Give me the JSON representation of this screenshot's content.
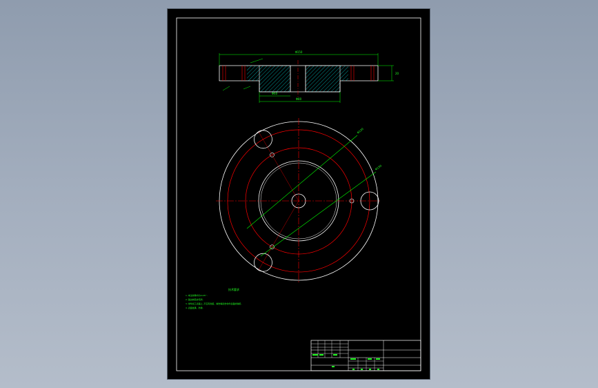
{
  "window": {
    "background": "#9aa6b6"
  },
  "colors": {
    "sheet": "#000000",
    "outline": "#ffffff",
    "centerline": "#ff0000",
    "dimension": "#00ff00",
    "section_hatch": "#00ffff",
    "annotation_text": "#22ff22"
  },
  "drawing": {
    "type": "flange part drawing",
    "views": [
      "section-view",
      "top-view"
    ],
    "top_view": {
      "bolt_holes_large": 3,
      "small_holes": 3
    },
    "dimension_labels": {
      "overall_width": "Φ150",
      "bolt_circle": "Φ120",
      "bore": "Φ60",
      "hub": "Φ80",
      "thickness": "20",
      "leader_1": "Φ120",
      "leader_2": "Φ150"
    },
    "technical_requirements": {
      "title": "技术要求",
      "lines": [
        "1.未注倒角均为1x45°.",
        "2.锐边倒钝去毛刺.",
        "3.零件加工表面上,不应有划痕、擦伤等损伤零件表面的缺陷.",
        "4.表面发黑、防锈."
      ]
    },
    "title_block": {
      "cells": [
        "",
        "",
        "",
        "",
        "",
        "",
        "",
        ""
      ]
    }
  }
}
